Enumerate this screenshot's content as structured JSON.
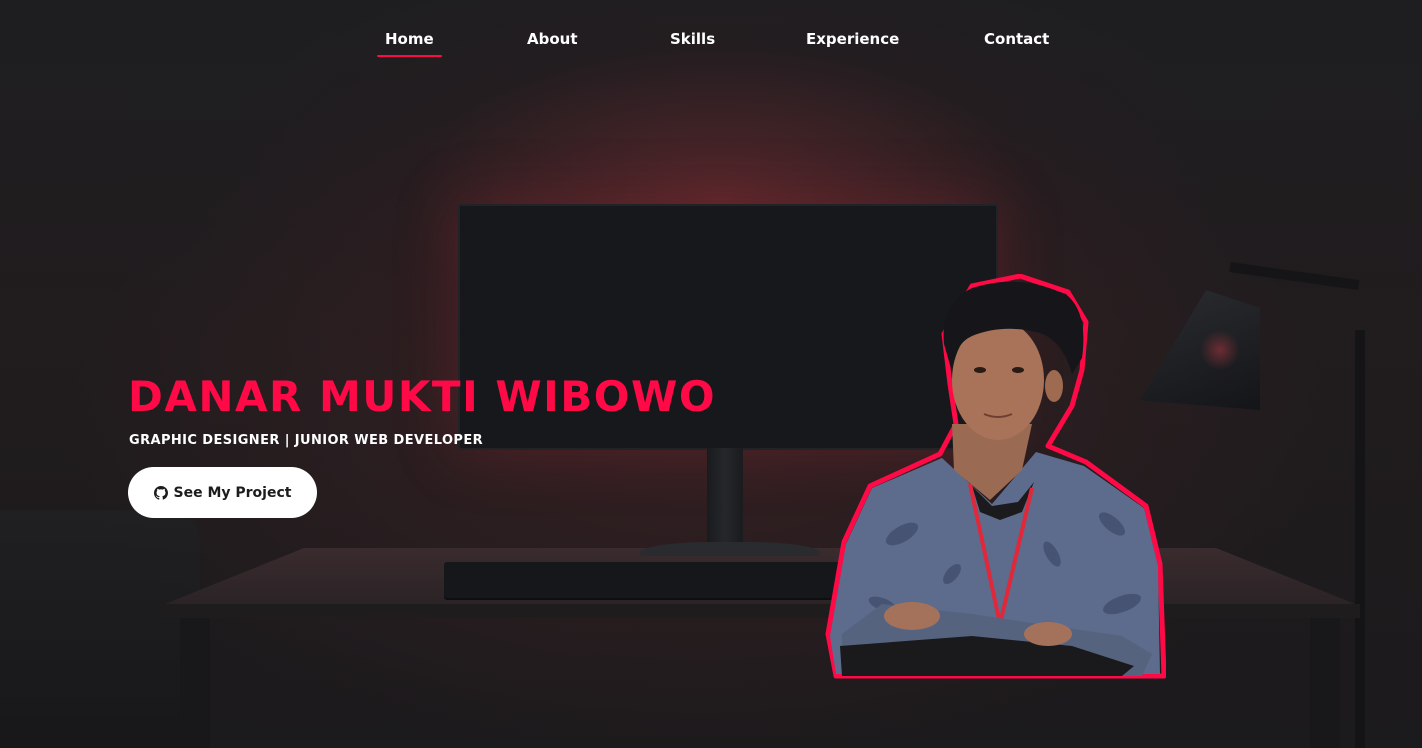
{
  "nav": {
    "items": [
      {
        "label": "Home",
        "active": true
      },
      {
        "label": "About",
        "active": false
      },
      {
        "label": "Skills",
        "active": false
      },
      {
        "label": "Experience",
        "active": false
      },
      {
        "label": "Contact",
        "active": false
      }
    ]
  },
  "hero": {
    "name": "DANAR MUKTI WIBOWO",
    "role": "GRAPHIC DESIGNER | JUNIOR WEB DEVELOPER",
    "cta_label": "See My Project",
    "cta_icon": "github-icon",
    "portrait": "person-photo-cutout"
  },
  "colors": {
    "accent": "#ff0a47",
    "text": "#ffffff",
    "background": "#1c1c1e",
    "button_bg": "#ffffff"
  }
}
